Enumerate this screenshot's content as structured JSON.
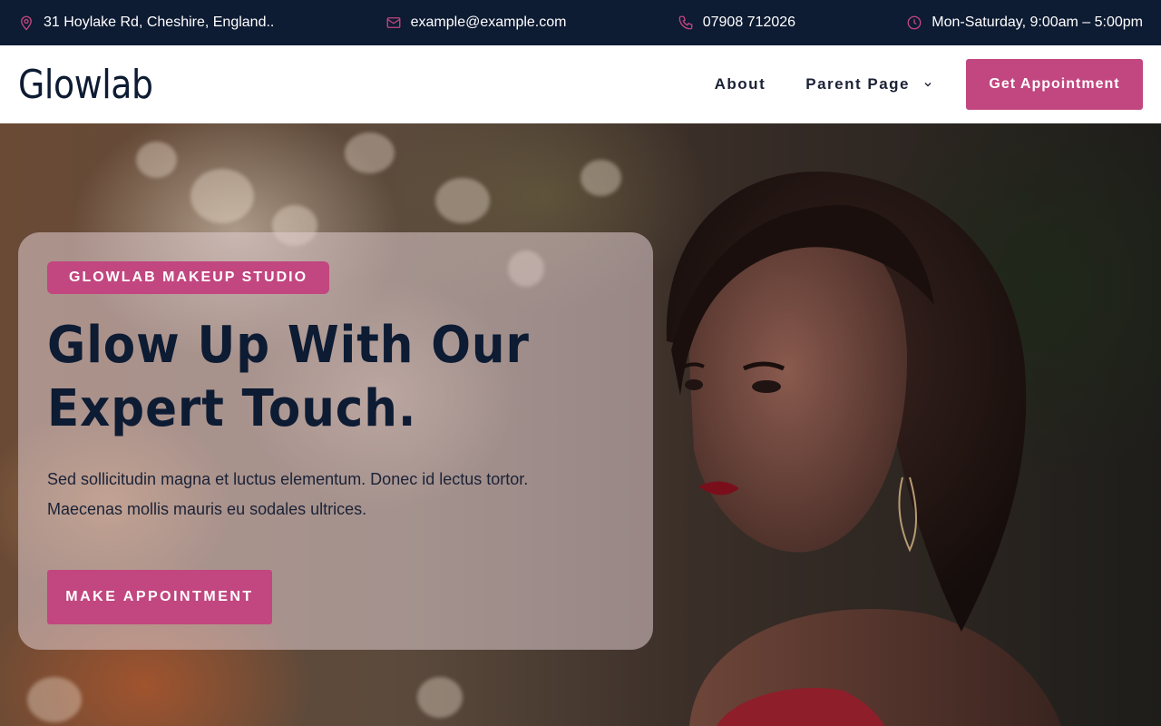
{
  "topbar": {
    "address": "31 Hoylake Rd, Cheshire, England..",
    "email": "example@example.com",
    "phone": "07908 712026",
    "hours": "Mon-Saturday, 9:00am – 5:00pm",
    "icons": [
      "map-pin-icon",
      "mail-icon",
      "phone-icon",
      "clock-icon"
    ],
    "icon_color": "#c2467f"
  },
  "header": {
    "logo": "Glowlab",
    "nav": [
      {
        "label": "About"
      },
      {
        "label": "Parent Page"
      }
    ],
    "cta": "Get Appointment"
  },
  "hero": {
    "tag": "GLOWLAB MAKEUP STUDIO",
    "headline": "Glow Up With Our Expert Touch.",
    "description": "Sed sollicitudin magna et luctus elementum. Donec id lectus tortor. Maecenas mollis mauris eu sodales ultrices.",
    "cta": "MAKE APPOINTMENT"
  },
  "colors": {
    "accent": "#c2467f",
    "dark": "#0d1b33"
  }
}
